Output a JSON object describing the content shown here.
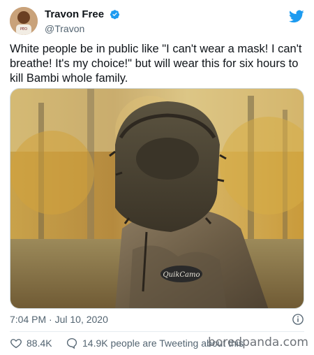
{
  "header": {
    "display_name": "Travon Free",
    "handle": "@Travon",
    "avatar_icon": "avatar-photo",
    "verified_icon": "verified-badge-icon",
    "logo_icon": "twitter-bird-icon"
  },
  "tweet": {
    "text": "White people be in public like \"I can't wear a mask! I can't breathe! It's my choice!\" but will wear this for six hours to kill Bambi whole family.",
    "media_caption_text": "QuikCamo"
  },
  "meta": {
    "timestamp": "7:04 PM · Jul 10, 2020",
    "info_icon": "info-icon"
  },
  "actions": {
    "likes": "88.4K",
    "replies_text": "14.9K people are Tweeting about this"
  },
  "watermark": "boredpanda.com",
  "colors": {
    "twitter_blue": "#1d9bf0",
    "text": "#0f1419",
    "secondary": "#536471",
    "border": "#cfd9de"
  }
}
